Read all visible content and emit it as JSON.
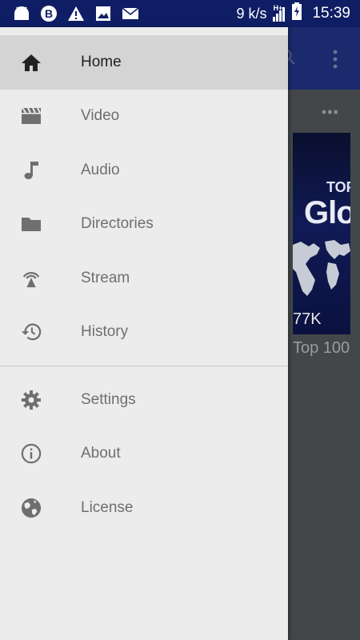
{
  "status_bar": {
    "speed": "9 k/s",
    "network": "H+",
    "time": "15:39"
  },
  "background": {
    "thumbnail_text_top": "TOP",
    "thumbnail_text_main": "Glo",
    "views": "77K",
    "title": "Top 100"
  },
  "drawer": {
    "items": [
      {
        "label": "Home",
        "icon": "home-icon"
      },
      {
        "label": "Video",
        "icon": "movie-icon"
      },
      {
        "label": "Audio",
        "icon": "music-note-icon"
      },
      {
        "label": "Directories",
        "icon": "folder-icon"
      },
      {
        "label": "Stream",
        "icon": "stream-icon"
      },
      {
        "label": "History",
        "icon": "history-icon"
      }
    ],
    "secondary": [
      {
        "label": "Settings",
        "icon": "gear-icon"
      },
      {
        "label": "About",
        "icon": "info-icon"
      },
      {
        "label": "License",
        "icon": "globe-icon"
      }
    ]
  },
  "colors": {
    "status_bar": "#0f1e64",
    "drawer_bg": "#ececec",
    "active_bg": "#d4d4d4",
    "icon_gray": "#6f6f6f"
  }
}
